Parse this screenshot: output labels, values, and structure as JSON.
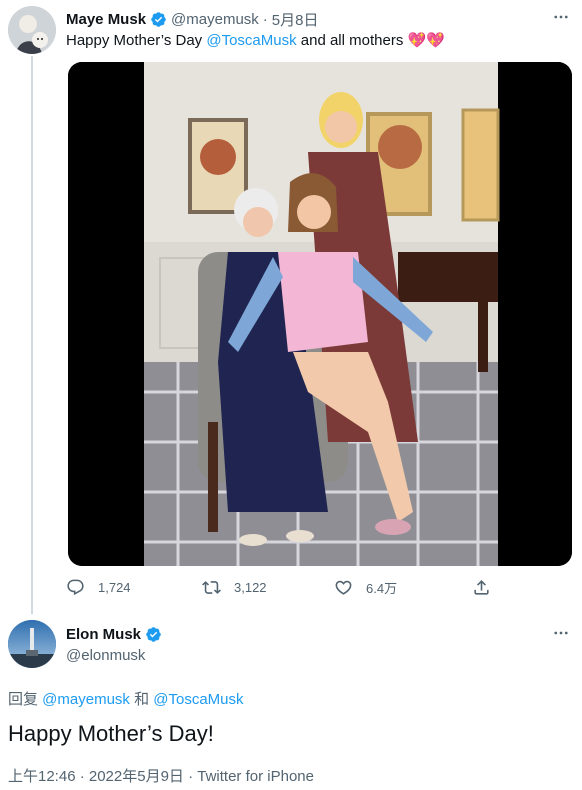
{
  "tweet1": {
    "name": "Maye Musk",
    "handle": "@mayemusk",
    "separator": "·",
    "time": "5月8日",
    "text_before": "Happy Mother’s Day ",
    "mention": "@ToscaMusk",
    "text_after": " and all mothers ",
    "hearts": "💖💖",
    "actions": {
      "replies": "1,724",
      "retweets": "3,122",
      "likes": "6.4万"
    }
  },
  "tweet2": {
    "name": "Elon Musk",
    "handle": "@elonmusk",
    "reply_prefix": "回复 ",
    "reply_mention1": "@mayemusk",
    "reply_and": " 和 ",
    "reply_mention2": "@ToscaMusk",
    "text": "Happy Mother’s Day!",
    "meta": "上午12:46 · 2022年5月9日 · Twitter for iPhone"
  },
  "icons": {
    "more": "more-icon",
    "verified": "verified-badge-icon",
    "reply": "reply-icon",
    "retweet": "retweet-icon",
    "like": "heart-icon",
    "share": "share-icon"
  },
  "colors": {
    "accent": "#1d9bf0",
    "secondary_text": "#536471",
    "heart": "#e0245e"
  }
}
